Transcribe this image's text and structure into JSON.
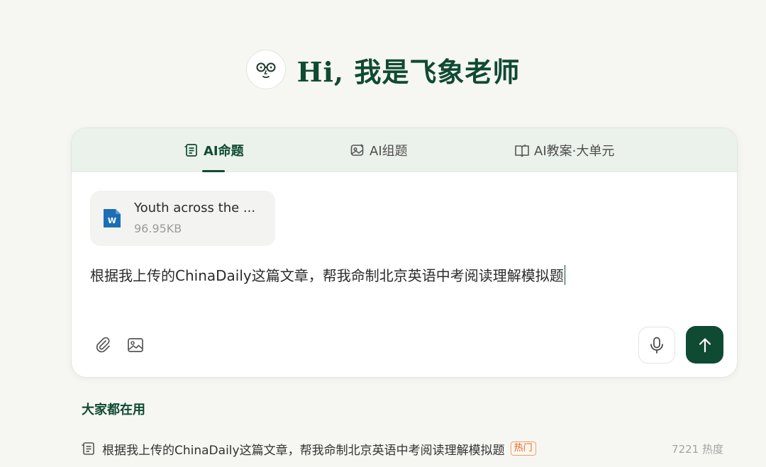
{
  "hero": {
    "title": "Hi, 我是飞象老师"
  },
  "tabs": [
    {
      "label": "AI命题",
      "icon": "list-edit-icon",
      "active": true
    },
    {
      "label": "AI组题",
      "icon": "image-star-icon",
      "active": false
    },
    {
      "label": "AI教案·大单元",
      "icon": "book-open-icon",
      "active": false
    }
  ],
  "file": {
    "icon": "word-doc-icon",
    "name": "Youth across the ...",
    "size": "96.95KB"
  },
  "prompt": {
    "text": "根据我上传的ChinaDaily这篇文章，帮我命制北京英语中考阅读理解模拟题"
  },
  "toolbar": {
    "attach_icon": "paperclip-icon",
    "image_icon": "image-icon",
    "mic_icon": "microphone-icon",
    "send_icon": "arrow-up-icon"
  },
  "popular": {
    "title": "大家都在用",
    "items": [
      {
        "text": "根据我上传的ChinaDaily这篇文章，帮我命制北京英语中考阅读理解模拟题",
        "badge": "热门",
        "heat": "7221 热度"
      }
    ]
  },
  "colors": {
    "brand": "#0f4a33",
    "background": "#f6f6f3",
    "tab_bar": "#ebf1eb",
    "hot_badge": "#e0661c"
  }
}
